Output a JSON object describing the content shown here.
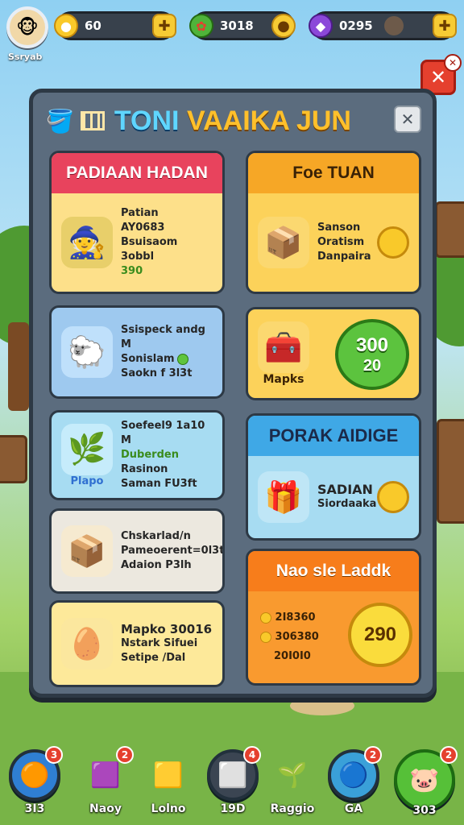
{
  "player": {
    "name": "Ssryab"
  },
  "resources": [
    {
      "icon": "gold-coin-icon",
      "value": "60"
    },
    {
      "icon": "flower-icon",
      "value": "3018"
    },
    {
      "icon": "purple-gem-icon",
      "value": "0295"
    }
  ],
  "panel": {
    "title_part1": "TONI",
    "title_part2": "VAAIKA JUN"
  },
  "cards_left": [
    {
      "header": "PADIAAN HADAN",
      "lines": [
        "Patian",
        "AY0683",
        "Bsuisaom 3obbl",
        "390"
      ]
    },
    {
      "lines": [
        "Ssispeck andg M",
        "Sonislam",
        "Saokn f 3l3t"
      ]
    },
    {
      "lines": [
        "Soefeel9 1a10 M",
        "Duberden",
        "Rasinon",
        "Saman FU3ft"
      ],
      "tag": "Plapo"
    },
    {
      "lines": [
        "Chskarlad/n",
        "Pameoerent=0l3t",
        "Adaion P3lh"
      ]
    },
    {
      "lines": [
        "Mapko 30016",
        "Nstark Sifuei",
        "Setipe /Dal"
      ]
    }
  ],
  "cards_right": [
    {
      "header": "Foe TUAN",
      "lines": [
        "Sanson",
        "Oratism",
        "Danpaira"
      ]
    },
    {
      "label": "Mapks",
      "button_top": "300",
      "button_bottom": "20"
    },
    {
      "header": "PORAK AIDIGE",
      "lines": [
        "SADIAN",
        "Siordaaka"
      ]
    },
    {
      "header": "Nao sle Laddk",
      "lines": [
        "2I8360",
        "306380",
        "20I0I0"
      ],
      "button": "290"
    }
  ],
  "bottom_nav": [
    {
      "label": "3I3",
      "badge": "3",
      "icon": "orange-blob-icon"
    },
    {
      "label": "Naoy",
      "badge": "2",
      "icon": "pink-chest-icon"
    },
    {
      "label": "Lolno",
      "badge": "",
      "icon": "gold-chest-icon"
    },
    {
      "label": "19D",
      "badge": "4",
      "icon": "white-cube-icon"
    },
    {
      "label": "Raggio",
      "badge": "",
      "icon": "plant-icon"
    },
    {
      "label": "GA",
      "badge": "2",
      "icon": "blue-orb-icon"
    },
    {
      "label": "303",
      "badge": "2",
      "icon": "pink-creature-icon"
    }
  ],
  "colors": {
    "accent_yellow": "#f7cb34",
    "panel_bg": "#5b6c7e",
    "close_red": "#e5402e"
  }
}
